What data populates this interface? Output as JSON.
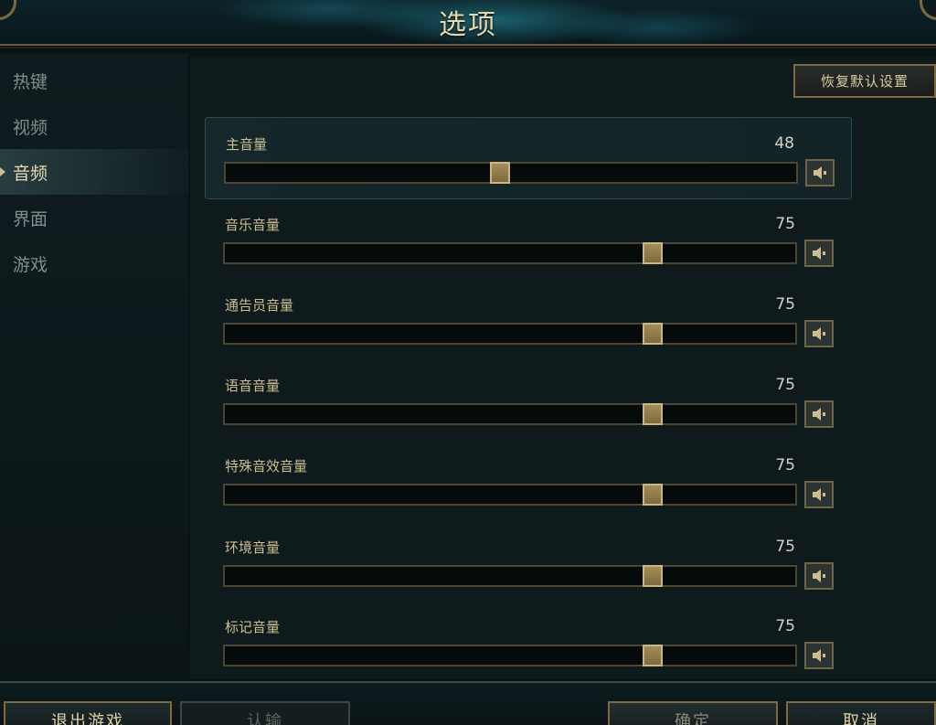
{
  "header": {
    "title": "选项"
  },
  "sidebar": {
    "items": [
      {
        "label": "热键",
        "active": false
      },
      {
        "label": "视频",
        "active": false
      },
      {
        "label": "音频",
        "active": true
      },
      {
        "label": "界面",
        "active": false
      },
      {
        "label": "游戏",
        "active": false
      }
    ]
  },
  "main": {
    "restore_label": "恢复默认设置",
    "volumes": [
      {
        "label": "主音量",
        "value": 48
      },
      {
        "label": "音乐音量",
        "value": 75
      },
      {
        "label": "通告员音量",
        "value": 75
      },
      {
        "label": "语音音量",
        "value": 75
      },
      {
        "label": "特殊音效音量",
        "value": 75
      },
      {
        "label": "环境音量",
        "value": 75
      },
      {
        "label": "标记音量",
        "value": 75
      }
    ]
  },
  "footer": {
    "exit_label": "退出游戏",
    "surrender_label": "认输",
    "confirm_label": "确定",
    "cancel_label": "取消"
  },
  "colors": {
    "gold": "#cdbe91",
    "gold_border": "#7d6a42",
    "panel": "#0e1a1c",
    "teal_accent": "#2896aa"
  },
  "icons": {
    "mute": "speaker-icon"
  }
}
